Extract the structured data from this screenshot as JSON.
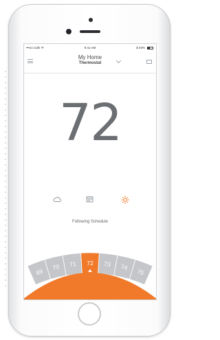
{
  "status_bar": {
    "carrier": "•••oo Cafe ᯤ",
    "time": "9:41 AM",
    "battery": "$ 40%"
  },
  "header": {
    "home_name": "My Home",
    "device_name": "Thermostat"
  },
  "thermostat": {
    "current_temperature": "72",
    "schedule_status": "Following Schedule",
    "modes": [
      {
        "name": "cool",
        "icon": "cloud-icon",
        "active": false
      },
      {
        "name": "schedule",
        "icon": "calendar-icon",
        "active": false
      },
      {
        "name": "heat",
        "icon": "sun-icon",
        "active": true
      }
    ],
    "dial": {
      "values": [
        "69",
        "70",
        "71",
        "72",
        "73",
        "74",
        "75"
      ],
      "selected": "72"
    }
  },
  "colors": {
    "accent": "#f07a2a",
    "dial_gray": "#c4c6c9",
    "icon_gray": "#8f959b"
  }
}
